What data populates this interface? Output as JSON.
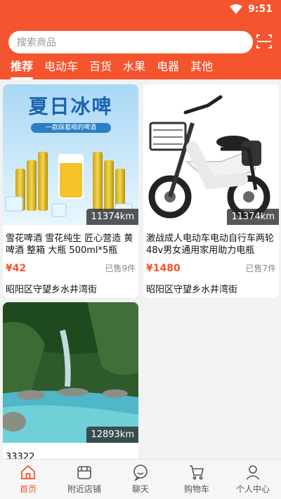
{
  "status": {
    "time": "9:51"
  },
  "search": {
    "placeholder": "搜索商品"
  },
  "tabs": [
    {
      "label": "推荐",
      "active": true
    },
    {
      "label": "电动车"
    },
    {
      "label": "百货"
    },
    {
      "label": "水果"
    },
    {
      "label": "电器"
    },
    {
      "label": "其他"
    }
  ],
  "products": [
    {
      "image_text": "夏日冰啤",
      "image_subtext": "一款踩着喝的啤酒",
      "distance": "11374km",
      "title": "雪花啤酒 雪花纯生 匠心营造 黄啤酒 整箱 大瓶 500ml*5瓶",
      "price": "¥42",
      "sold": "已售9件",
      "location": "昭阳区守望乡水井湾街"
    },
    {
      "distance": "11374km",
      "title": "激战成人电动车电动自行车两轮48v男女通用家用助力电瓶",
      "price": "¥1480",
      "sold": "已售7件",
      "location": "昭阳区守望乡水井湾街"
    },
    {
      "distance": "12893km",
      "title": "33322"
    }
  ],
  "nav": [
    {
      "label": "首页",
      "icon": "home-icon",
      "active": true
    },
    {
      "label": "附近店铺",
      "icon": "shop-icon"
    },
    {
      "label": "聊天",
      "icon": "chat-icon"
    },
    {
      "label": "购物车",
      "icon": "cart-icon"
    },
    {
      "label": "个人中心",
      "icon": "user-icon"
    }
  ],
  "colors": {
    "accent": "#f4542e"
  }
}
